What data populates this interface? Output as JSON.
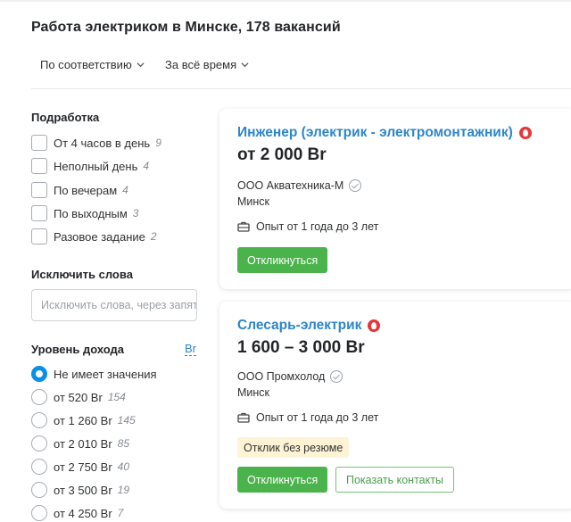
{
  "header": {
    "title": "Работа электриком в Минске, 178 вакансий",
    "sort_relevance": "По соответствию",
    "sort_period": "За всё время"
  },
  "sidebar": {
    "parttime": {
      "title": "Подработка",
      "items": [
        {
          "label": "От 4 часов в день",
          "count": "9"
        },
        {
          "label": "Неполный день",
          "count": "4"
        },
        {
          "label": "По вечерам",
          "count": "4"
        },
        {
          "label": "По выходным",
          "count": "3"
        },
        {
          "label": "Разовое задание",
          "count": "2"
        }
      ]
    },
    "exclude": {
      "title": "Исключить слова",
      "placeholder": "Исключить слова, через запятую"
    },
    "income": {
      "title": "Уровень дохода",
      "currency": "Br",
      "options": [
        {
          "label": "Не имеет значения",
          "count": "",
          "checked": true
        },
        {
          "label": "от 520 Br",
          "count": "154",
          "checked": false
        },
        {
          "label": "от 1 260 Br",
          "count": "145",
          "checked": false
        },
        {
          "label": "от 2 010 Br",
          "count": "85",
          "checked": false
        },
        {
          "label": "от 2 750 Br",
          "count": "40",
          "checked": false
        },
        {
          "label": "от 3 500 Br",
          "count": "19",
          "checked": false
        },
        {
          "label": "от 4 250 Br",
          "count": "7",
          "checked": false
        }
      ]
    }
  },
  "vacancies": [
    {
      "title": "Инженер (электрик - электромонтажник)",
      "salary": "от 2 000 Br",
      "company": "ООО Акватехника-М",
      "city": "Минск",
      "experience": "Опыт от 1 года до 3 лет",
      "respond_label": "Откликнуться"
    },
    {
      "title": "Слесарь-электрик",
      "salary": "1 600 – 3 000 Br",
      "company": "ООО Промхолод",
      "city": "Минск",
      "experience": "Опыт от 1 года до 3 лет",
      "badge": "Отклик без резюме",
      "respond_label": "Откликнуться",
      "contacts_label": "Показать контакты"
    }
  ],
  "colors": {
    "link": "#2e86c8",
    "accent_green": "#4bb34b",
    "radio_checked": "#0a8fe8",
    "hot_icon": "#e5363a",
    "badge_bg": "#fff3d6"
  }
}
